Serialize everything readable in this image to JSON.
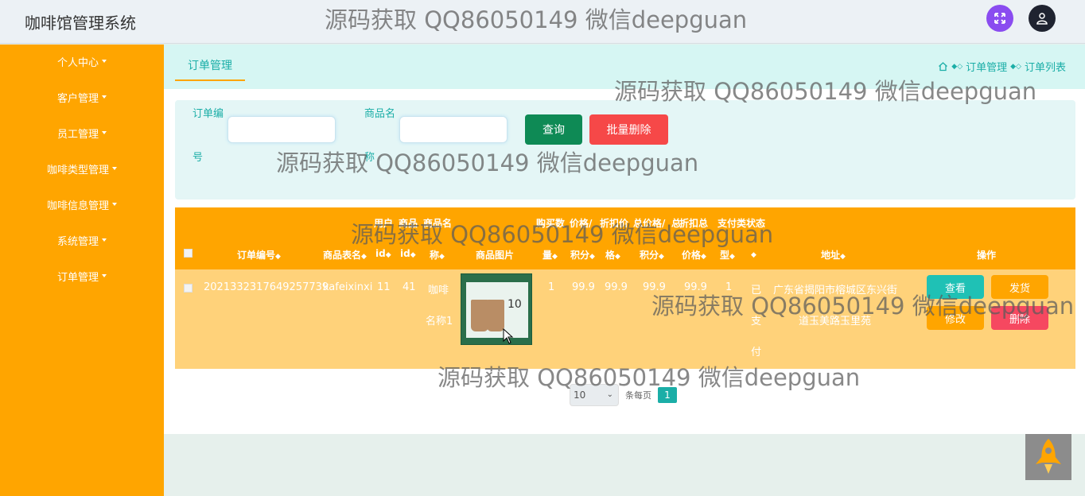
{
  "app": {
    "title": "咖啡馆管理系统"
  },
  "header": {
    "expand_icon": "expand-icon",
    "user_icon": "user-icon",
    "expand_color": "#8a4cf0",
    "user_color": "#1f2330"
  },
  "sidebar": {
    "background": "#ffa500",
    "items": [
      {
        "label": "个人中心"
      },
      {
        "label": "客户管理"
      },
      {
        "label": "员工管理"
      },
      {
        "label": "咖啡类型管理"
      },
      {
        "label": "咖啡信息管理"
      },
      {
        "label": "系统管理"
      },
      {
        "label": "订单管理"
      }
    ]
  },
  "tab": {
    "label": "订单管理"
  },
  "breadcrumb": {
    "home_icon": "home-icon",
    "items": [
      "订单管理",
      "订单列表"
    ]
  },
  "search": {
    "order_no_label_1": "订单编",
    "order_no_label_2": "号",
    "goods_name_label_1": "商品名",
    "goods_name_label_2": "称",
    "order_no_value": "",
    "goods_name_value": "",
    "query_label": "查询",
    "batch_delete_label": "批量删除"
  },
  "table": {
    "header_top": {
      "t1": "用户",
      "t2": "商品",
      "t3": "商品名",
      "t4": "购买数",
      "t5": "价格/",
      "t6": "折扣价",
      "t7": "总价格/",
      "t8": "总",
      "t9": "折扣总",
      "t10": "支付类",
      "t11": "状态"
    },
    "headers": {
      "order_no": "订单编号",
      "table_name": "商品表名",
      "user_id": "id",
      "goods_id": "id",
      "goods_name": "称",
      "image": "商品图片",
      "qty": "量",
      "price": "积分",
      "discount_price": "格",
      "total_price": "积分",
      "total": "价格",
      "pay_type": "型",
      "status": "",
      "address": "地址",
      "operation": "操作"
    },
    "rows": [
      {
        "order_no": "2021332317649257739",
        "table_name": "kafeixinxi",
        "user_id": "11",
        "goods_id": "41",
        "goods_name_1": "咖啡",
        "goods_name_2": "名称1",
        "qty": "1",
        "price": "99.9",
        "discount_price": "99.9",
        "total_price": "99.9",
        "discount_total": "99.9",
        "pay_type": "1",
        "status_1": "已",
        "status_2": "支",
        "status_3": "付",
        "address_1": "广东省揭阳市榕城区东兴街",
        "address_2": "道玉美路玉里苑",
        "thumb_price": "10",
        "actions": {
          "view": "查看",
          "ship": "发货",
          "edit": "修改",
          "delete": "删除"
        }
      }
    ]
  },
  "pagination": {
    "page_size": "10",
    "per_page_label": "条每页",
    "current_page": "1"
  },
  "watermark": {
    "text": "源码获取 QQ86050149 微信deepguan"
  },
  "colors": {
    "accent": "#1baea7",
    "sidebar": "#ffa500",
    "query": "#0e8a55",
    "danger": "#f64848"
  }
}
